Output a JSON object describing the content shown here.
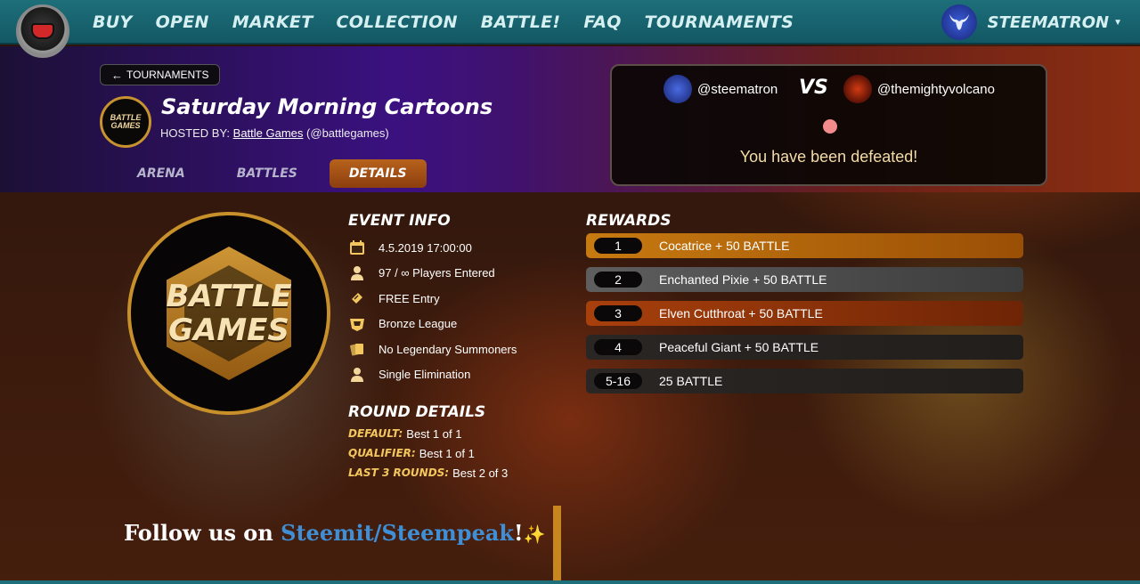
{
  "nav": {
    "items": [
      "BUY",
      "OPEN",
      "MARKET",
      "COLLECTION",
      "BATTLE!",
      "FAQ",
      "TOURNAMENTS"
    ],
    "username": "STEEMATRON"
  },
  "header": {
    "back_label": "TOURNAMENTS",
    "title": "Saturday Morning Cartoons",
    "hosted_by_label": "HOSTED BY:",
    "host_name": "Battle Games",
    "host_handle": "(@battlegames)",
    "host_logo_text": "BATTLE GAMES",
    "tabs": [
      "ARENA",
      "BATTLES",
      "DETAILS"
    ],
    "active_tab": "DETAILS"
  },
  "battle": {
    "player1": "@steematron",
    "vs": "VS",
    "player2": "@themightyvolcano",
    "result": "You have been defeated!"
  },
  "big_logo": {
    "line1": "BATTLE",
    "line2": "GAMES"
  },
  "event_info": {
    "heading": "EVENT INFO",
    "rows": [
      {
        "icon": "calendar-icon",
        "text": "4.5.2019 17:00:00"
      },
      {
        "icon": "player-icon",
        "text": "97 / ∞ Players Entered"
      },
      {
        "icon": "ticket-icon",
        "text": "FREE Entry"
      },
      {
        "icon": "league-icon",
        "text": "Bronze League"
      },
      {
        "icon": "cards-icon",
        "text": "No Legendary Summoners"
      },
      {
        "icon": "player-icon",
        "text": "Single Elimination"
      }
    ]
  },
  "round_details": {
    "heading": "ROUND DETAILS",
    "rows": [
      {
        "key": "DEFAULT:",
        "value": "Best 1 of 1"
      },
      {
        "key": "QUALIFIER:",
        "value": "Best 1 of 1"
      },
      {
        "key": "LAST 3 ROUNDS:",
        "value": "Best 2 of 3"
      }
    ]
  },
  "rewards": {
    "heading": "REWARDS",
    "rows": [
      {
        "rank": "1",
        "prize": "Cocatrice + 50 BATTLE"
      },
      {
        "rank": "2",
        "prize": "Enchanted Pixie + 50 BATTLE"
      },
      {
        "rank": "3",
        "prize": "Elven Cutthroat + 50 BATTLE"
      },
      {
        "rank": "4",
        "prize": "Peaceful Giant + 50 BATTLE"
      },
      {
        "rank": "5-16",
        "prize": "25 BATTLE"
      }
    ]
  },
  "follow": {
    "prefix": "Follow us on ",
    "link": "Steemit/Steempeak",
    "suffix": "!",
    "sparkle": "✨"
  },
  "colors": {
    "nav_bg": "#1d6f7a",
    "accent_gold": "#f3c75e",
    "active_tab": "#b7621c",
    "link_blue": "#3f8fd6"
  }
}
